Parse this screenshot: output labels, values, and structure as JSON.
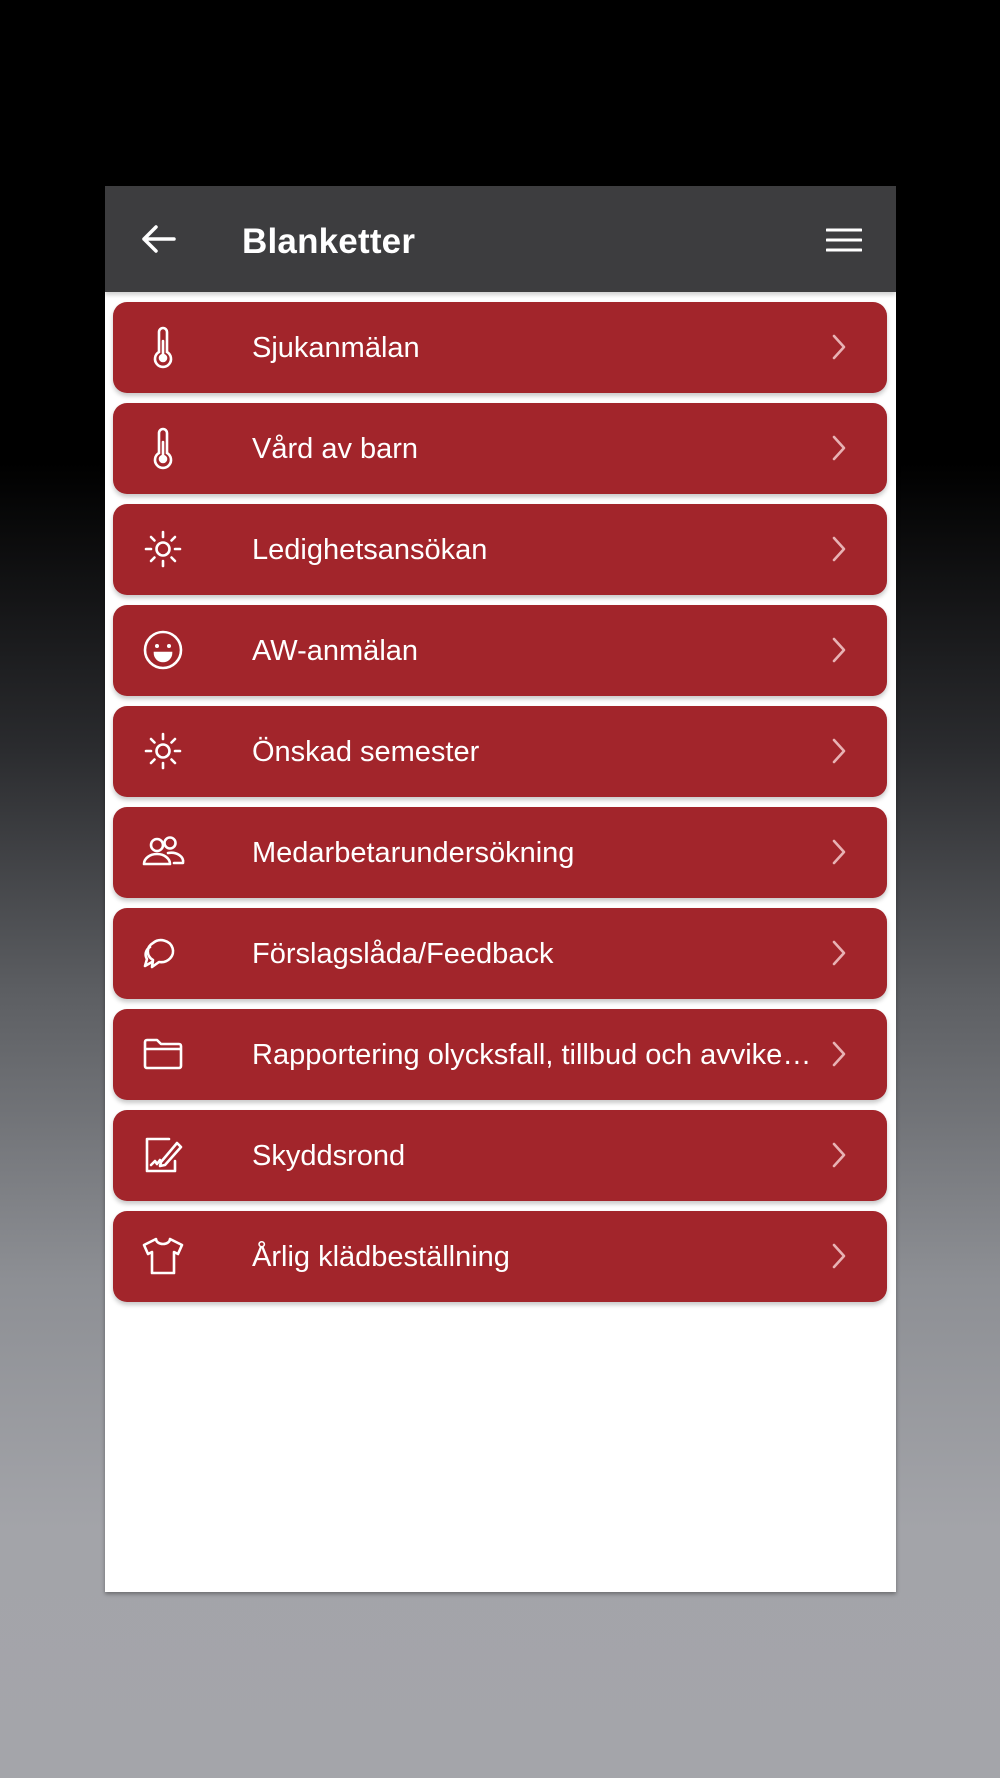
{
  "header": {
    "title": "Blanketter",
    "back_icon": "arrow-left-icon",
    "menu_icon": "hamburger-menu-icon"
  },
  "colors": {
    "appbar": "#3d3d3f",
    "item_background": "#a2252b",
    "item_text": "#ffffff",
    "chevron": "#e8b2b4"
  },
  "items": [
    {
      "label": "Sjukanmälan",
      "icon": "thermometer-icon"
    },
    {
      "label": "Vård av barn",
      "icon": "thermometer-icon"
    },
    {
      "label": "Ledighetsansökan",
      "icon": "sun-icon"
    },
    {
      "label": "AW-anmälan",
      "icon": "smiley-icon"
    },
    {
      "label": "Önskad semester",
      "icon": "sun-icon"
    },
    {
      "label": "Medarbetarundersökning",
      "icon": "people-icon"
    },
    {
      "label": "Förslagslåda/Feedback",
      "icon": "chat-bubbles-icon"
    },
    {
      "label": "Rapportering olycksfall, tillbud och avvikelser",
      "icon": "folder-icon"
    },
    {
      "label": "Skyddsrond",
      "icon": "document-signature-icon"
    },
    {
      "label": "Årlig klädbeställning",
      "icon": "tshirt-icon"
    }
  ]
}
